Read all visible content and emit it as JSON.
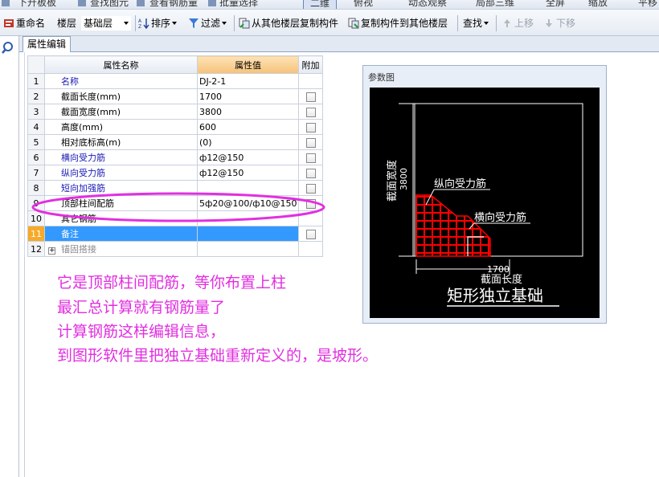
{
  "top_strip": {
    "items": [
      "下升板板",
      "查找图元",
      "查看钢筋量",
      "批量选择",
      "二维",
      "俯视",
      "动态观察",
      "局部三维",
      "全屏",
      "缩放",
      "平移"
    ]
  },
  "toolbar": {
    "rename_label": "重命名",
    "floor_label": "楼层",
    "floor_value": "基础层",
    "sort_label": "排序",
    "filter_label": "过滤",
    "copy_from_label": "从其他楼层复制构件",
    "copy_to_label": "复制构件到其他楼层",
    "find_label": "查找",
    "move_up_label": "上移",
    "move_down_label": "下移"
  },
  "tab": {
    "label": "属性编辑"
  },
  "grid": {
    "headers": {
      "name": "属性名称",
      "value": "属性值",
      "extra": "附加"
    },
    "rows": [
      {
        "no": "1",
        "name": "名称",
        "value": "DJ-2-1",
        "color": "blue",
        "checkbox": false
      },
      {
        "no": "2",
        "name": "截面长度(mm)",
        "value": "1700",
        "color": "black",
        "checkbox": true
      },
      {
        "no": "3",
        "name": "截面宽度(mm)",
        "value": "3800",
        "color": "black",
        "checkbox": true
      },
      {
        "no": "4",
        "name": "高度(mm)",
        "value": "600",
        "color": "black",
        "checkbox": true
      },
      {
        "no": "5",
        "name": "相对底标高(m)",
        "value": "(0)",
        "color": "black",
        "checkbox": true
      },
      {
        "no": "6",
        "name": "横向受力筋",
        "value": "ф12@150",
        "color": "blue",
        "checkbox": true
      },
      {
        "no": "7",
        "name": "纵向受力筋",
        "value": "ф12@150",
        "color": "blue",
        "checkbox": true
      },
      {
        "no": "8",
        "name": "短向加强筋",
        "value": "",
        "color": "blue",
        "checkbox": true
      },
      {
        "no": "9",
        "name": "顶部柱间配筋",
        "value": "5ф20@100/ф10@150",
        "color": "black",
        "checkbox": true
      },
      {
        "no": "10",
        "name": "其它钢筋",
        "value": "",
        "color": "black",
        "checkbox": false
      },
      {
        "no": "11",
        "name": "备注",
        "value": "",
        "color": "white",
        "checkbox": true,
        "selected": true
      },
      {
        "no": "12",
        "name": "锚固搭接",
        "value": "",
        "color": "gray",
        "checkbox": false,
        "expandable": true,
        "expander": "+"
      }
    ]
  },
  "diagram": {
    "title": "参数图",
    "width_label": "截面宽度",
    "width_value": "3800",
    "long_rebar_label": "纵向受力筋",
    "trans_rebar_label": "横向受力筋",
    "length_value": "1700",
    "length_label": "截面长度",
    "caption": "矩形独立基础"
  },
  "notes": [
    "它是顶部柱间配筋，等你布置上柱",
    "最汇总计算就有钢筋量了",
    "计算钢筋这样编辑信息，",
    "到图形软件里把独立基础重新定义的，是坡形。"
  ],
  "colors": {
    "annotation": "#e22fe0",
    "selection": "#3399ff",
    "row_selected_no": "#f7a928",
    "rebar": "#ff0000"
  }
}
